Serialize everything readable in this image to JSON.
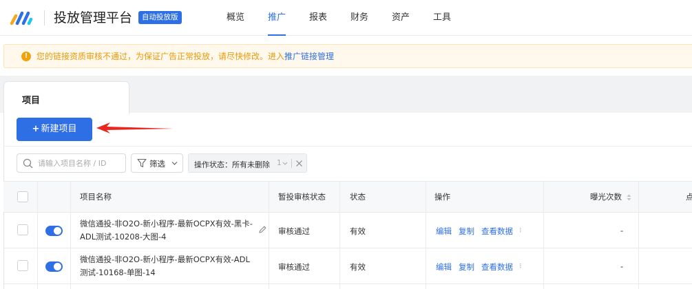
{
  "header": {
    "app_title": "投放管理平台",
    "auto_badge": "自动投放版",
    "nav": [
      {
        "label": "概览",
        "active": false
      },
      {
        "label": "推广",
        "active": true
      },
      {
        "label": "报表",
        "active": false
      },
      {
        "label": "财务",
        "active": false
      },
      {
        "label": "资产",
        "active": false
      },
      {
        "label": "工具",
        "active": false
      }
    ]
  },
  "warning": {
    "text": "您的链接资质审核不通过，为保证广告正常投放，请尽快修改。进入",
    "link": "推广链接管理"
  },
  "tab": {
    "label": "项目"
  },
  "new_project_label": "新建项目",
  "filters": {
    "search_placeholder": "请输入项目名称 / ID",
    "filter_label": "筛选",
    "chip_label": "操作状态：所有未删除",
    "chip_count": "1"
  },
  "table": {
    "headers": {
      "name": "项目名称",
      "review": "暂投审核状态",
      "status": "状态",
      "ops": "操作",
      "impressions": "曝光次数",
      "clicks": "点"
    },
    "rows": [
      {
        "name": "微信通投-非O2O-新小程序-最新OCPX有效-黑卡-ADL测试-10208-大图-4",
        "review": "审核通过",
        "status": "有效",
        "actions": [
          "编辑",
          "复制",
          "查看数据"
        ],
        "impressions": "-",
        "toggle_on": true
      },
      {
        "name": "微信通投-非O2O-新小程序-最新OCPX有效-ADL测试-10168-单图-14",
        "review": "审核通过",
        "status": "有效",
        "actions": [
          "编辑",
          "复制",
          "查看数据"
        ],
        "impressions": "-",
        "toggle_on": true
      }
    ]
  },
  "colors": {
    "primary": "#2f6fe6",
    "warning_text": "#e89b0a",
    "warning_bg": "#fff8ec",
    "annotation_arrow": "#e8271f"
  }
}
